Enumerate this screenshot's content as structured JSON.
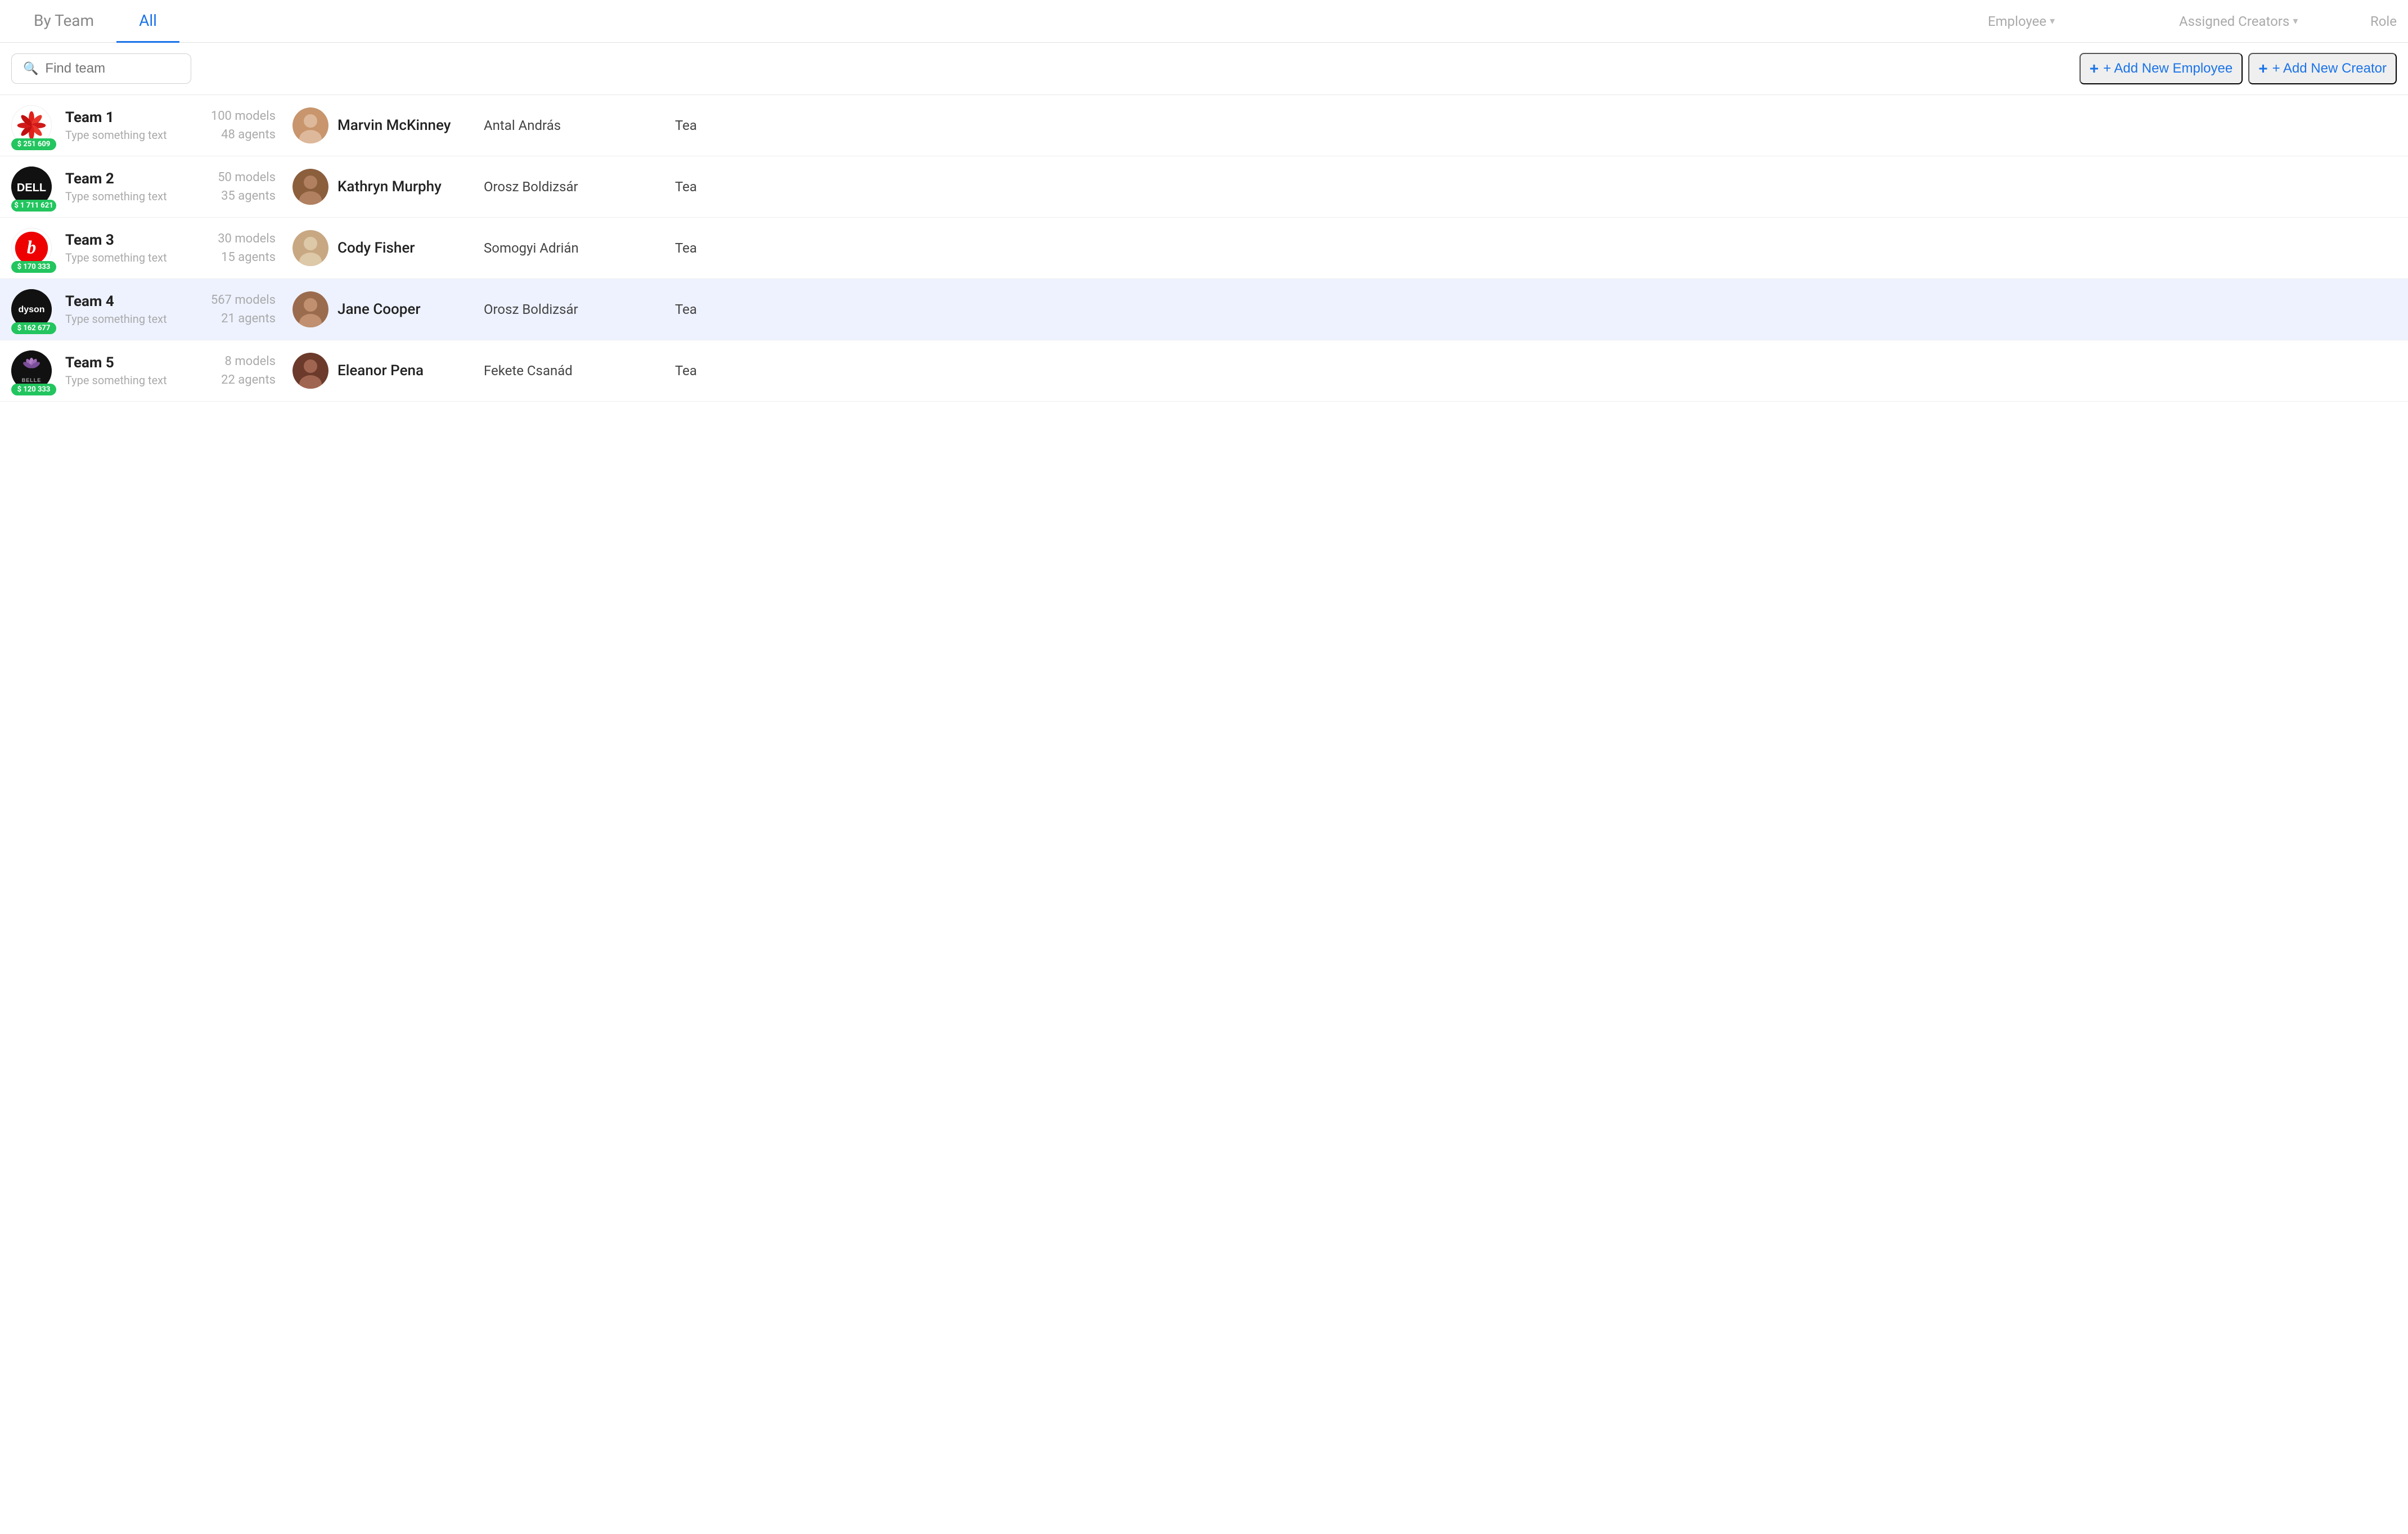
{
  "tabs": [
    {
      "id": "by-team",
      "label": "By Team",
      "active": false
    },
    {
      "id": "all",
      "label": "All",
      "active": true
    }
  ],
  "col_headers": {
    "employee": "Employee",
    "assigned_creators": "Assigned Creators",
    "role": "Role"
  },
  "toolbar": {
    "search_placeholder": "Find team",
    "add_employee_label": "+ Add New Employee",
    "add_creator_label": "+ Add New Creator"
  },
  "teams": [
    {
      "id": 1,
      "name": "Team 1",
      "sub": "Type something text",
      "badge": "$ 251 609",
      "models": "100 models",
      "agents": "48 agents",
      "employee_name": "Marvin McKinney",
      "creator": "Antal András",
      "role": "Tea",
      "logo_type": "huawei",
      "selected": false
    },
    {
      "id": 2,
      "name": "Team 2",
      "sub": "Type something text",
      "badge": "$ 1 711 621",
      "models": "50 models",
      "agents": "35 agents",
      "employee_name": "Kathryn Murphy",
      "creator": "Orosz Boldizsár",
      "role": "Tea",
      "logo_type": "dell",
      "selected": false
    },
    {
      "id": 3,
      "name": "Team 3",
      "sub": "Type something text",
      "badge": "$ 170 333",
      "models": "30 models",
      "agents": "15 agents",
      "employee_name": "Cody Fisher",
      "creator": "Somogyi Adrián",
      "role": "Tea",
      "logo_type": "beats",
      "selected": false
    },
    {
      "id": 4,
      "name": "Team 4",
      "sub": "Type something text",
      "badge": "$ 162 677",
      "models": "567 models",
      "agents": "21 agents",
      "employee_name": "Jane Cooper",
      "creator": "Orosz Boldizsár",
      "role": "Tea",
      "logo_type": "dyson",
      "selected": true
    },
    {
      "id": 5,
      "name": "Team 5",
      "sub": "Type something text",
      "badge": "$ 120 333",
      "models": "8 models",
      "agents": "22 agents",
      "employee_name": "Eleanor Pena",
      "creator": "Fekete Csanád",
      "role": "Tea",
      "logo_type": "belle",
      "selected": false
    }
  ]
}
